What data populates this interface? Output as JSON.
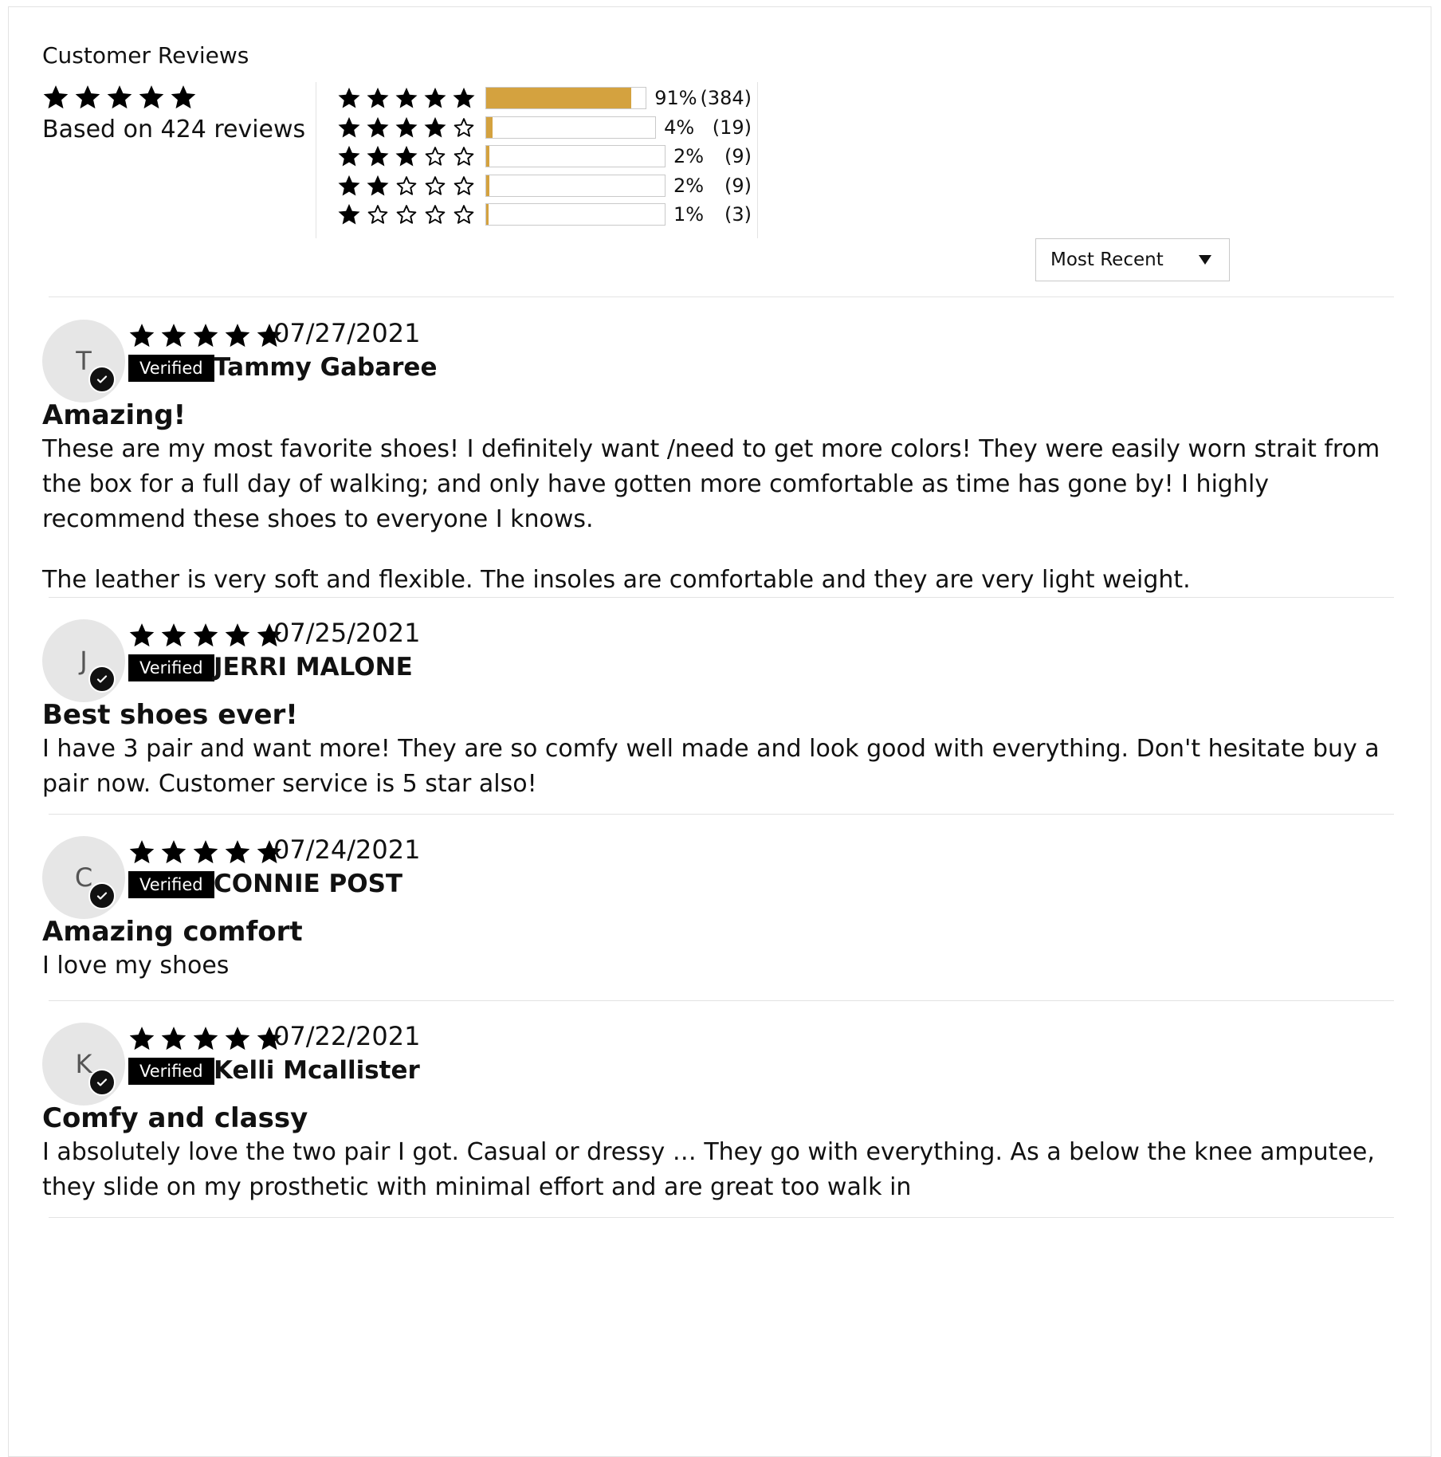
{
  "header": {
    "title": "Customer Reviews",
    "average_rating": 5,
    "based_on": "Based on 424 reviews"
  },
  "histogram": [
    {
      "stars": 5,
      "percent": "91%",
      "count": "(384)",
      "fraction": 0.91
    },
    {
      "stars": 4,
      "percent": "4%",
      "count": "(19)",
      "fraction": 0.04
    },
    {
      "stars": 3,
      "percent": "2%",
      "count": "(9)",
      "fraction": 0.02
    },
    {
      "stars": 2,
      "percent": "2%",
      "count": "(9)",
      "fraction": 0.02
    },
    {
      "stars": 1,
      "percent": "1%",
      "count": "(3)",
      "fraction": 0.01
    }
  ],
  "sort": {
    "selected": "Most Recent"
  },
  "colors": {
    "bar_fill": "#d4a23f",
    "star": "#000000",
    "verified_bg": "#000000"
  },
  "reviews": [
    {
      "initial": "T",
      "rating": 5,
      "date": "07/27/2021",
      "verified_label": "Verified",
      "name": "Tammy Gabaree",
      "title": "Amazing!",
      "body": [
        "These are my most favorite shoes! I definitely want /need to get more colors! They were easily worn strait from the box for a full day of walking; and only have gotten more comfortable as time has gone by! I highly recommend these shoes to everyone I knows.",
        "The leather is very soft and flexible. The insoles are comfortable and they are very light weight."
      ]
    },
    {
      "initial": "J",
      "rating": 5,
      "date": "07/25/2021",
      "verified_label": "Verified",
      "name": "JERRI MALONE",
      "title": "Best shoes ever!",
      "body": [
        "I have 3 pair and want more! They are so comfy well made and look good with everything. Don't hesitate buy a pair now. Customer service is 5 star also!"
      ]
    },
    {
      "initial": "C",
      "rating": 5,
      "date": "07/24/2021",
      "verified_label": "Verified",
      "name": "CONNIE POST",
      "title": "Amazing comfort",
      "body": [
        "I love my shoes"
      ]
    },
    {
      "initial": "K",
      "rating": 5,
      "date": "07/22/2021",
      "verified_label": "Verified",
      "name": "Kelli Mcallister",
      "title": "Comfy and classy",
      "body": [
        "I absolutely love the two pair I got. Casual or dressy … They go with everything. As a below the knee amputee, they slide on my prosthetic with minimal effort and are great too walk in"
      ]
    }
  ]
}
